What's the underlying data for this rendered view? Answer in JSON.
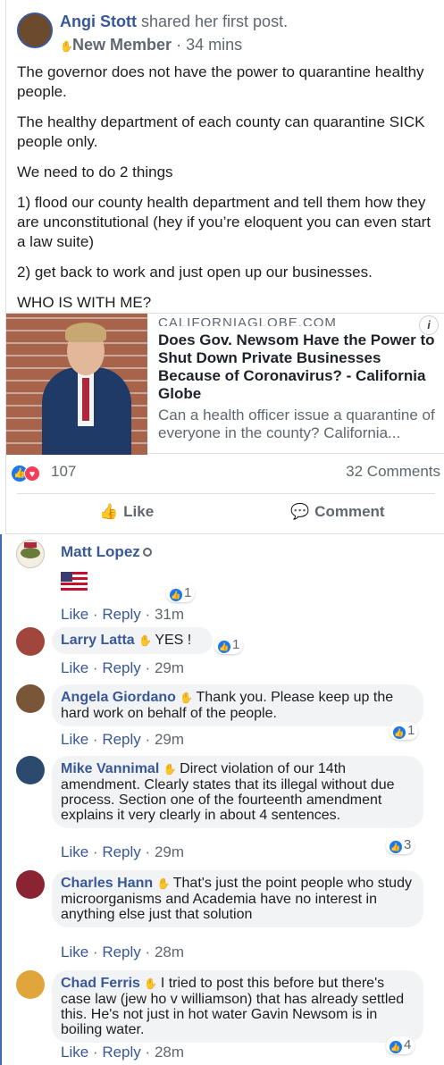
{
  "post": {
    "author": "Angi Stott",
    "shared_text": "shared her first post.",
    "badge": "New Member",
    "separator": "·",
    "time": "34 mins",
    "paragraphs": [
      "The governor does not have the power to quarantine healthy people.",
      "The healthy department of each county can quarantine SICK people only.",
      "We need to do 2 things",
      "1) flood our county health department and tell them how they are unconstitutional (hey if you’re eloquent you can even start a law suite)",
      "2) get back to work and just open up our businesses.",
      "WHO IS WITH ME?"
    ],
    "link": {
      "domain": "CALIFORNIAGLOBE.COM",
      "title": "Does Gov. Newsom Have the Power to Shut Down Private Businesses Because of Coronavirus? - California Globe",
      "description": "Can a health officer issue a quarantine of everyone in the county? California...",
      "info_label": "i"
    },
    "reaction_count": "107",
    "comments_count": "32 Comments",
    "actions": {
      "like": "Like",
      "comment": "Comment"
    }
  },
  "icons": {
    "like_action": "thumbs-up-outline-icon",
    "comment_action": "speech-bubble-icon",
    "reaction_like": "like-reaction-icon",
    "reaction_love": "love-reaction-icon",
    "member_hand": "waving-hand-icon"
  },
  "colors": {
    "link_blue": "#385898",
    "like_blue": "#1877f2",
    "love_red": "#f33e58",
    "bubble_bg": "#f2f3f5"
  },
  "comment_actions": {
    "like": "Like",
    "reply": "Reply",
    "separator": "·"
  },
  "comments": [
    {
      "name": "Matt Lopez",
      "text": "",
      "time": "31m",
      "reactions": "1"
    },
    {
      "name": "Larry Latta",
      "text": "YES !",
      "time": "29m",
      "reactions": "1"
    },
    {
      "name": "Angela Giordano",
      "text": "Thank you. Please keep up the hard work on behalf of the people.",
      "time": "29m",
      "reactions": "1"
    },
    {
      "name": "Mike Vannimal",
      "text": "Direct violation of our 14th amendment. Clearly states that its illegal without due process. Section one of the fourteenth amendment explains it very clearly in about 4 sentences.",
      "time": "29m",
      "reactions": "3"
    },
    {
      "name": "Charles Hann",
      "text": "That's just the point people who study microorganisms and Academia have no interest in anything else just that solution",
      "time": "28m",
      "reactions": ""
    },
    {
      "name": "Chad Ferris",
      "text": "I tried to post this before but there's case law (jew ho v williamson) that has already settled this. He's not just in hot water Gavin Newsom is in boiling water.",
      "time": "28m",
      "reactions": "4"
    }
  ]
}
